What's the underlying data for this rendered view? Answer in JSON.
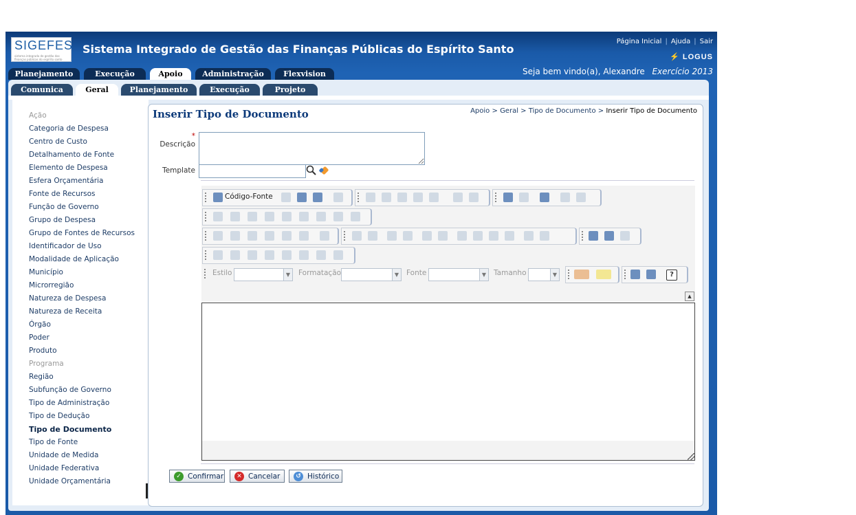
{
  "header": {
    "logo_text": "SIGEFES",
    "logo_subtext": "sistema integrado de gestão das finanças públicas do espírito santo",
    "title": "Sistema Integrado de Gestão das Finanças Públicas do Espírito Santo",
    "links": [
      "Página Inicial",
      "Ajuda",
      "Sair"
    ],
    "brand": "LOGUS",
    "welcome": "Seja bem vindo(a), Alexandre",
    "exercise": "Exercício 2013"
  },
  "main_tabs": [
    {
      "label": "Planejamento",
      "active": false
    },
    {
      "label": "Execução",
      "active": false
    },
    {
      "label": "Apoio",
      "active": true
    },
    {
      "label": "Administração",
      "active": false
    },
    {
      "label": "Flexvision",
      "active": false
    }
  ],
  "sub_tabs": [
    {
      "label": "Comunica",
      "active": false
    },
    {
      "label": "Geral",
      "active": true
    },
    {
      "label": "Planejamento",
      "active": false
    },
    {
      "label": "Execução",
      "active": false
    },
    {
      "label": "Projeto",
      "active": false
    }
  ],
  "sidebar": {
    "items": [
      {
        "label": "Ação",
        "state": "disabled"
      },
      {
        "label": "Categoria de Despesa",
        "state": "normal"
      },
      {
        "label": "Centro de Custo",
        "state": "normal"
      },
      {
        "label": "Detalhamento de Fonte",
        "state": "normal"
      },
      {
        "label": "Elemento de Despesa",
        "state": "normal"
      },
      {
        "label": "Esfera Orçamentária",
        "state": "normal"
      },
      {
        "label": "Fonte de Recursos",
        "state": "normal"
      },
      {
        "label": "Função de Governo",
        "state": "normal"
      },
      {
        "label": "Grupo de Despesa",
        "state": "normal"
      },
      {
        "label": "Grupo de Fontes de Recursos",
        "state": "normal"
      },
      {
        "label": "Identificador de Uso",
        "state": "normal"
      },
      {
        "label": "Modalidade de Aplicação",
        "state": "normal"
      },
      {
        "label": "Município",
        "state": "normal"
      },
      {
        "label": "Microrregião",
        "state": "normal"
      },
      {
        "label": "Natureza de Despesa",
        "state": "normal"
      },
      {
        "label": "Natureza de Receita",
        "state": "normal"
      },
      {
        "label": "Órgão",
        "state": "normal"
      },
      {
        "label": "Poder",
        "state": "normal"
      },
      {
        "label": "Produto",
        "state": "normal"
      },
      {
        "label": "Programa",
        "state": "disabled"
      },
      {
        "label": "Região",
        "state": "normal"
      },
      {
        "label": "Subfunção de Governo",
        "state": "normal"
      },
      {
        "label": "Tipo de Administração",
        "state": "normal"
      },
      {
        "label": "Tipo de Dedução",
        "state": "normal"
      },
      {
        "label": "Tipo de Documento",
        "state": "current"
      },
      {
        "label": "Tipo de Fonte",
        "state": "normal"
      },
      {
        "label": "Unidade de Medida",
        "state": "normal"
      },
      {
        "label": "Unidade Federativa",
        "state": "normal"
      },
      {
        "label": "Unidade Orçamentária",
        "state": "normal"
      }
    ]
  },
  "page": {
    "title": "Inserir Tipo de Documento",
    "breadcrumb": [
      "Apoio",
      "Geral",
      "Tipo de Documento",
      "Inserir Tipo de Documento"
    ],
    "breadcrumb_sep": ">",
    "required_mark": "*",
    "description_label": "Descrição",
    "description_value": "",
    "template_label": "Template",
    "template_value": ""
  },
  "editor": {
    "source_label": "Código-Fonte",
    "style_label": "Estilo",
    "format_label": "Formatação",
    "font_label": "Fonte",
    "size_label": "Tamanho",
    "help_glyph": "?"
  },
  "buttons": {
    "confirm": "Confirmar",
    "cancel": "Cancelar",
    "history": "Histórico"
  },
  "colors": {
    "header_blue": "#1a5aa8",
    "dark_tab": "#0c2c55",
    "link_blue": "#1d3c66",
    "title_blue": "#0d3a7a"
  }
}
